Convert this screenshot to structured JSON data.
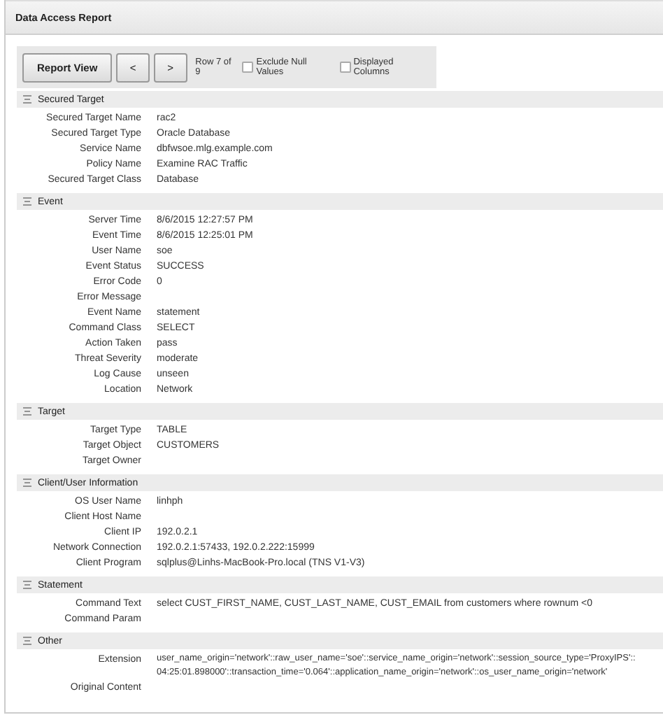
{
  "window": {
    "title": "Data Access Report"
  },
  "toolbar": {
    "buttons": [
      {
        "label": "Report View"
      },
      {
        "label": "<"
      },
      {
        "label": ">"
      }
    ],
    "row_status": "Row 7 of 9",
    "checkboxes": [
      {
        "label": "Exclude Null Values",
        "checked": false
      },
      {
        "label": "Displayed Columns",
        "checked": false
      }
    ]
  },
  "sections": [
    {
      "title": "Secured Target",
      "fields": [
        {
          "label": "Secured Target Name",
          "value": "rac2"
        },
        {
          "label": "Secured Target Type",
          "value": "Oracle Database"
        },
        {
          "label": "Service Name",
          "value": "dbfwsoe.mlg.example.com"
        },
        {
          "label": "Policy Name",
          "value": "Examine RAC Traffic"
        },
        {
          "label": "Secured Target Class",
          "value": "Database"
        }
      ]
    },
    {
      "title": "Event",
      "fields": [
        {
          "label": "Server Time",
          "value": "8/6/2015 12:27:57 PM"
        },
        {
          "label": "Event Time",
          "value": "8/6/2015 12:25:01 PM"
        },
        {
          "label": "User Name",
          "value": "soe"
        },
        {
          "label": "Event Status",
          "value": "SUCCESS"
        },
        {
          "label": "Error Code",
          "value": "0"
        },
        {
          "label": "Error Message"
        },
        {
          "label": "Event Name",
          "value": "statement"
        },
        {
          "label": "Command Class",
          "value": "SELECT"
        },
        {
          "label": "Action Taken",
          "value": "pass"
        },
        {
          "label": "Threat Severity",
          "value": "moderate"
        },
        {
          "label": "Log Cause",
          "value": "unseen"
        },
        {
          "label": "Location",
          "value": "Network"
        }
      ]
    },
    {
      "title": "Target",
      "fields": [
        {
          "label": "Target Type",
          "value": "TABLE"
        },
        {
          "label": "Target Object",
          "value": "CUSTOMERS"
        },
        {
          "label": "Target Owner"
        }
      ]
    },
    {
      "title": "Client/User Information",
      "fields": [
        {
          "label": "OS User Name",
          "value": "linhph"
        },
        {
          "label": "Client Host Name"
        },
        {
          "label": "Client IP",
          "value": "192.0.2.1"
        },
        {
          "label": "Network Connection",
          "value": "192.0.2.1:57433, 192.0.2.222:15999"
        },
        {
          "label": "Client Program",
          "value": "sqlplus@Linhs-MacBook-Pro.local (TNS V1-V3)"
        }
      ]
    },
    {
      "title": "Statement",
      "fields": [
        {
          "label": "Command Text",
          "value": "select CUST_FIRST_NAME, CUST_LAST_NAME, CUST_EMAIL from customers where rownum <0"
        },
        {
          "label": "Command Param"
        }
      ]
    },
    {
      "title": "Other",
      "fields": [
        {
          "label": "Extension",
          "value_lines": [
            "user_name_origin='network'::raw_user_name='soe'::service_name_origin='network'::session_source_type='ProxyIPS'::",
            "04:25:01.898000'::transaction_time='0.064'::application_name_origin='network'::os_user_name_origin='network'"
          ]
        },
        {
          "label": "Original Content"
        }
      ]
    }
  ]
}
